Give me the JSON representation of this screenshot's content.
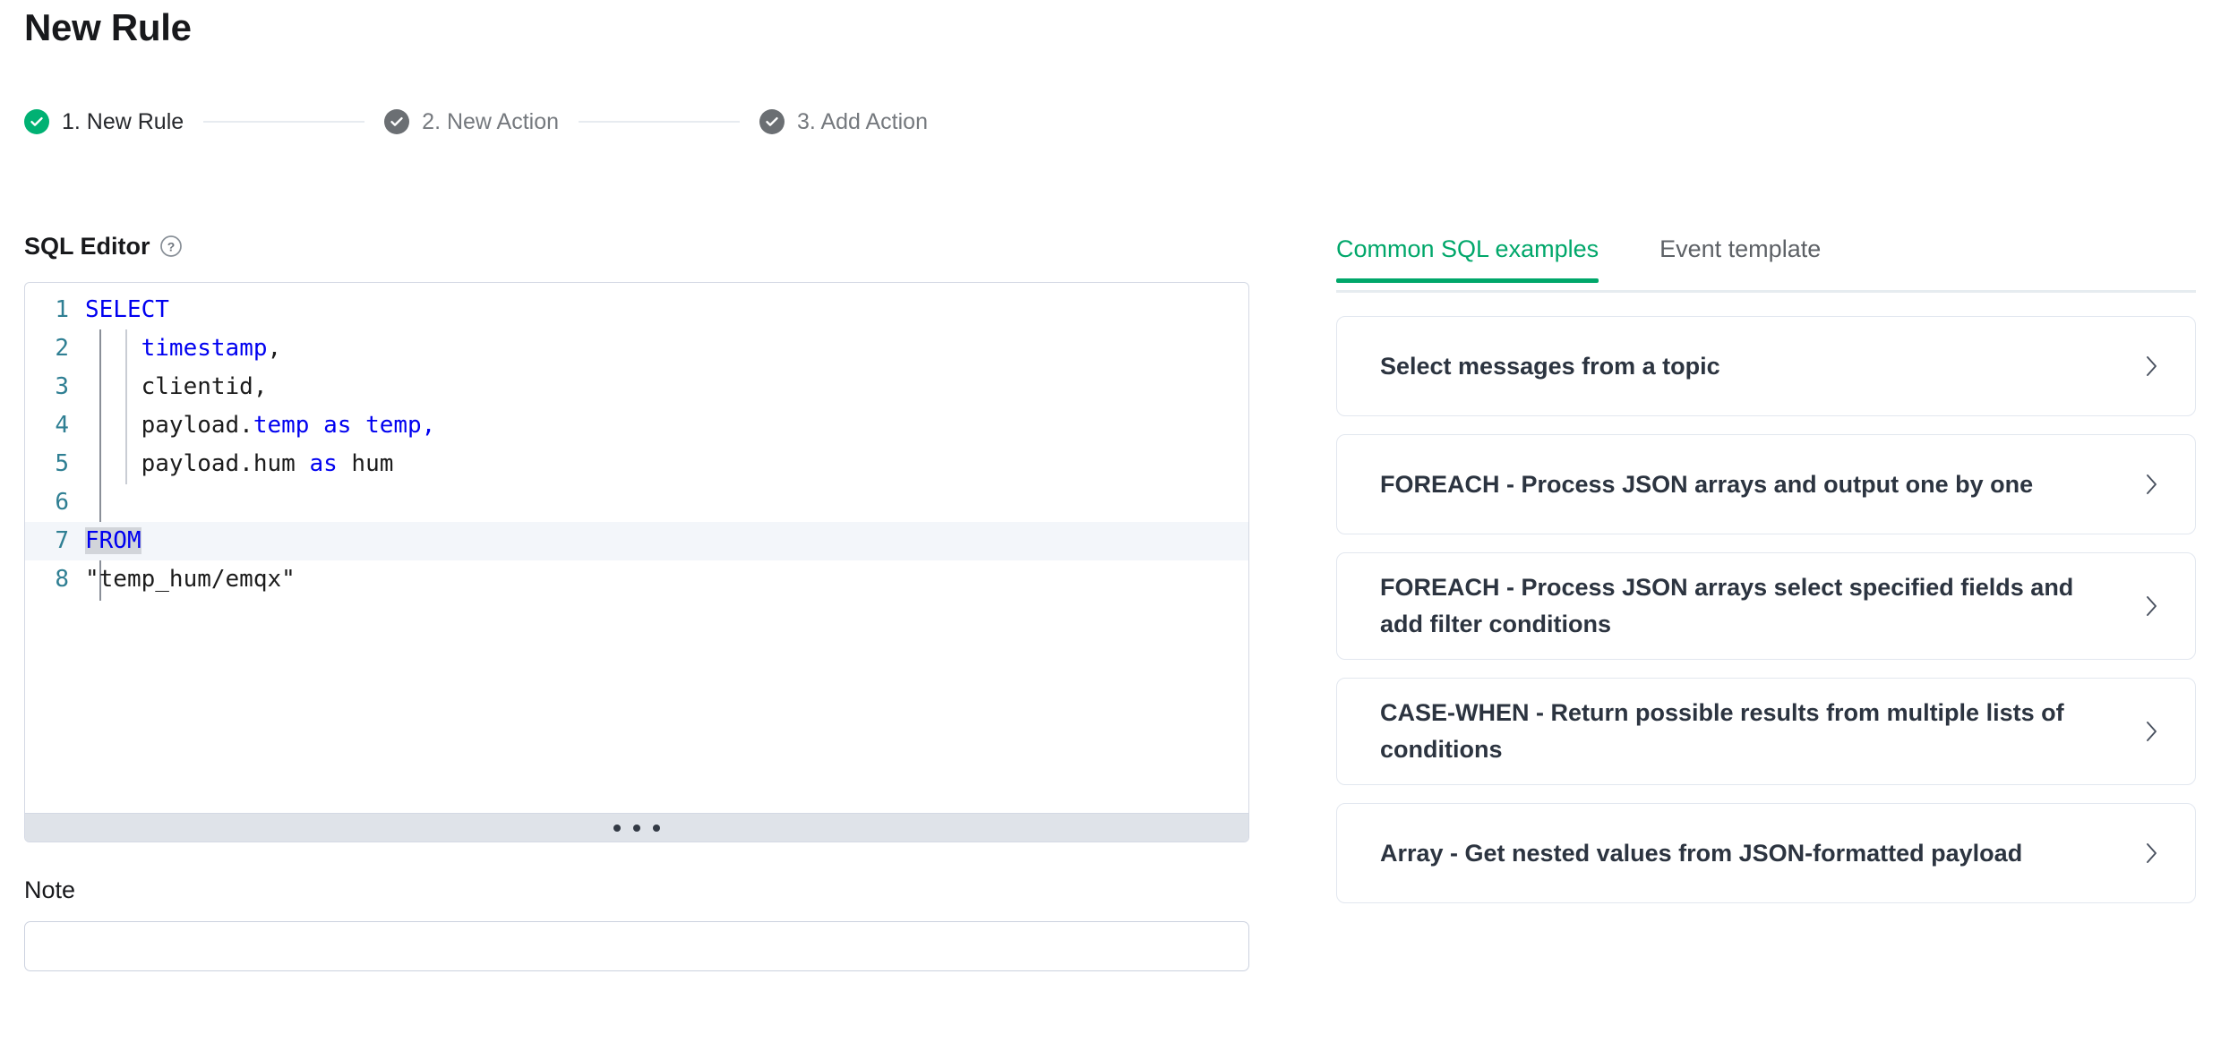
{
  "header": {
    "title": "New Rule"
  },
  "stepper": {
    "steps": [
      {
        "label": "1. New Rule",
        "state": "done",
        "icon": "check-circle-icon"
      },
      {
        "label": "2. New Action",
        "state": "pending",
        "icon": "check-circle-icon"
      },
      {
        "label": "3. Add Action",
        "state": "pending",
        "icon": "check-circle-icon"
      }
    ]
  },
  "editor": {
    "section_label": "SQL Editor",
    "help_icon": "question-circle-icon",
    "resize_handle_icon": "ellipsis-horizontal-icon",
    "line_numbers": [
      "1",
      "2",
      "3",
      "4",
      "5",
      "6",
      "7",
      "8"
    ],
    "lines": [
      {
        "n": "1",
        "active": false,
        "tokens": [
          {
            "t": "SELECT",
            "c": "kw"
          }
        ]
      },
      {
        "n": "2",
        "active": false,
        "tokens": [
          {
            "t": "    ",
            "c": "plain"
          },
          {
            "t": "timestamp",
            "c": "kw"
          },
          {
            "t": ",",
            "c": "plain"
          }
        ]
      },
      {
        "n": "3",
        "active": false,
        "tokens": [
          {
            "t": "    clientid,",
            "c": "plain"
          }
        ]
      },
      {
        "n": "4",
        "active": false,
        "tokens": [
          {
            "t": "    payload.",
            "c": "plain"
          },
          {
            "t": "temp as temp,",
            "c": "kw"
          }
        ]
      },
      {
        "n": "5",
        "active": false,
        "tokens": [
          {
            "t": "    payload.hum ",
            "c": "plain"
          },
          {
            "t": "as",
            "c": "kw"
          },
          {
            "t": " hum",
            "c": "plain"
          }
        ]
      },
      {
        "n": "6",
        "active": false,
        "tokens": [
          {
            "t": "",
            "c": "plain"
          }
        ]
      },
      {
        "n": "7",
        "active": true,
        "tokens": [
          {
            "t": "FROM",
            "c": "sel"
          }
        ]
      },
      {
        "n": "8",
        "active": false,
        "tokens": [
          {
            "t": "\"temp_hum/emqx\"",
            "c": "str"
          }
        ]
      }
    ]
  },
  "note": {
    "label": "Note",
    "value": "",
    "placeholder": ""
  },
  "right_panel": {
    "tabs": [
      {
        "label": "Common SQL examples",
        "active": true
      },
      {
        "label": "Event template",
        "active": false
      }
    ],
    "examples": [
      {
        "title": "Select messages from a topic",
        "chevron": "chevron-right-icon"
      },
      {
        "title": "FOREACH - Process JSON arrays and output one by one",
        "chevron": "chevron-right-icon"
      },
      {
        "title": "FOREACH - Process JSON arrays select specified fields and add filter conditions",
        "chevron": "chevron-right-icon"
      },
      {
        "title": "CASE-WHEN - Return possible results from multiple lists of conditions",
        "chevron": "chevron-right-icon"
      },
      {
        "title": "Array - Get nested values from JSON-formatted payload",
        "chevron": "chevron-right-icon"
      }
    ]
  },
  "colors": {
    "accent_green": "#00a76a",
    "step_done": "#00b173",
    "step_pending": "#6b6f73",
    "keyword_blue": "#0000f0",
    "line_number_teal": "#2f7f93",
    "active_line_bg": "#f3f6fa",
    "selection_bg": "#d2d5da"
  }
}
